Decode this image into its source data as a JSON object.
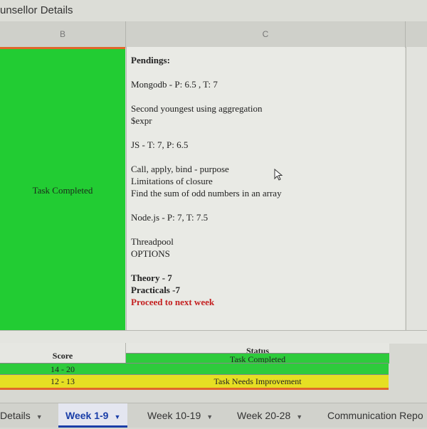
{
  "title": "unsellor Details",
  "columns": {
    "b": "B",
    "c": "C"
  },
  "cell_b": {
    "text": "Task Completed"
  },
  "cell_c": {
    "pendings": "Pendings:",
    "mongodb": "Mongodb - P: 6.5 , T: 7",
    "second_youngest": "Second youngest using aggregation",
    "expr": "$expr",
    "js": "JS - T: 7, P: 6.5",
    "call_apply": "Call, apply, bind - purpose",
    "closure": "Limitations of closure",
    "odd_numbers": "Find the sum of odd numbers in an array",
    "node": "Node.js - P: 7, T: 7.5",
    "threadpool": "Threadpool",
    "options": "OPTIONS",
    "theory": "Theory -  7",
    "practicals": "Practicals -7",
    "proceed": "Proceed to next week"
  },
  "legend": {
    "score_header": "Score",
    "status_header": "Status",
    "rows": [
      {
        "range": "14 - 20",
        "status": "Task Completed",
        "color": "#2ecb3c"
      },
      {
        "range": "12 - 13",
        "status": "Task Needs Improvement",
        "color": "#e6df23"
      }
    ]
  },
  "tabs": [
    {
      "label": "Details",
      "active": false
    },
    {
      "label": "Week 1-9",
      "active": true
    },
    {
      "label": "Week 10-19",
      "active": false
    },
    {
      "label": "Week 20-28",
      "active": false
    },
    {
      "label": "Communication Repo",
      "active": false
    }
  ],
  "colors": {
    "completed_green": "#22cc33",
    "accent_orange": "#e0672b",
    "warning_red": "#c42020",
    "active_tab_blue": "#1a3ea8"
  }
}
